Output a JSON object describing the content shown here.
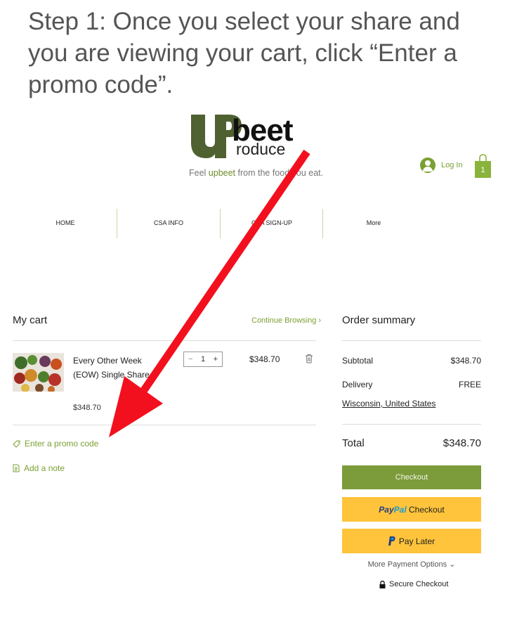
{
  "instruction": {
    "text": "Step 1: Once you select your share and you are viewing your cart, click “Enter a promo code”."
  },
  "brand": {
    "logo_beet": "beet",
    "logo_roduce": "roduce",
    "tagline_pre": "Feel ",
    "tagline_brand": "upbeet",
    "tagline_post": " from the food you eat.",
    "accent": "#7aa033",
    "logo_dark": "#4f6131"
  },
  "header": {
    "login_label": "Log In",
    "cart_count": "1"
  },
  "nav": {
    "items": [
      {
        "label": "HOME"
      },
      {
        "label": "CSA INFO"
      },
      {
        "label": "CSA SIGN-UP"
      },
      {
        "label": "More"
      }
    ]
  },
  "cart": {
    "title": "My cart",
    "continue_label": "Continue Browsing ›",
    "item": {
      "name": "Every Other Week (EOW) Single Share",
      "unit_price": "$348.70",
      "quantity": "1",
      "line_total": "$348.70"
    },
    "promo_label": "Enter a promo code",
    "note_label": "Add a note"
  },
  "summary": {
    "title": "Order summary",
    "subtotal_label": "Subtotal",
    "subtotal_value": "$348.70",
    "delivery_label": "Delivery",
    "delivery_value": "FREE",
    "location": "Wisconsin, United States",
    "total_label": "Total",
    "total_value": "$348.70",
    "checkout_label": "Checkout",
    "paypal_brand_a": "Pay",
    "paypal_brand_b": "Pal",
    "paypal_label": " Checkout",
    "paylater_label": "Pay Later",
    "more_options": "More Payment Options ⌄",
    "secure": "Secure Checkout"
  },
  "annotation": {
    "arrow_color": "#f3101e"
  }
}
